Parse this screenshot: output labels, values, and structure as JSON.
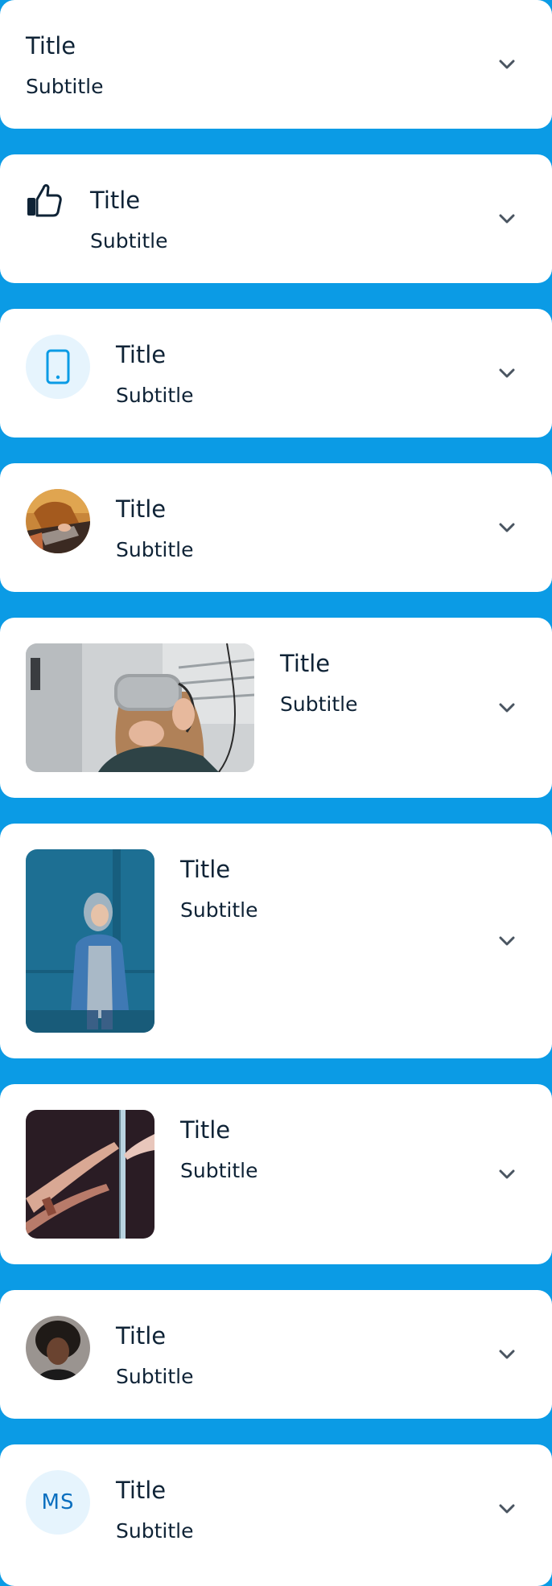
{
  "colors": {
    "background": "#0b9be5",
    "card": "#ffffff",
    "text": "#0f2336",
    "chevron": "#4a5561",
    "icon_bg": "#e6f4fd",
    "accent": "#0b9be5"
  },
  "items": [
    {
      "variant": "text-only",
      "title": "Title",
      "subtitle": "Subtitle",
      "trailing_icon": "chevron-down-icon"
    },
    {
      "variant": "icon",
      "leading_icon": "thumbs-up-icon",
      "title": "Title",
      "subtitle": "Subtitle",
      "trailing_icon": "chevron-down-icon"
    },
    {
      "variant": "icon-circle",
      "leading_icon": "smartphone-icon",
      "title": "Title",
      "subtitle": "Subtitle",
      "trailing_icon": "chevron-down-icon"
    },
    {
      "variant": "avatar",
      "title": "Title",
      "subtitle": "Subtitle",
      "trailing_icon": "chevron-down-icon"
    },
    {
      "variant": "landscape-image",
      "title": "Title",
      "subtitle": "Subtitle",
      "trailing_icon": "chevron-down-icon"
    },
    {
      "variant": "portrait-image",
      "title": "Title",
      "subtitle": "Subtitle",
      "trailing_icon": "chevron-down-icon"
    },
    {
      "variant": "square-image",
      "title": "Title",
      "subtitle": "Subtitle",
      "trailing_icon": "chevron-down-icon"
    },
    {
      "variant": "avatar",
      "title": "Title",
      "subtitle": "Subtitle",
      "trailing_icon": "chevron-down-icon"
    },
    {
      "variant": "initials",
      "initials": "MS",
      "title": "Title",
      "subtitle": "Subtitle",
      "trailing_icon": "chevron-down-icon"
    }
  ]
}
